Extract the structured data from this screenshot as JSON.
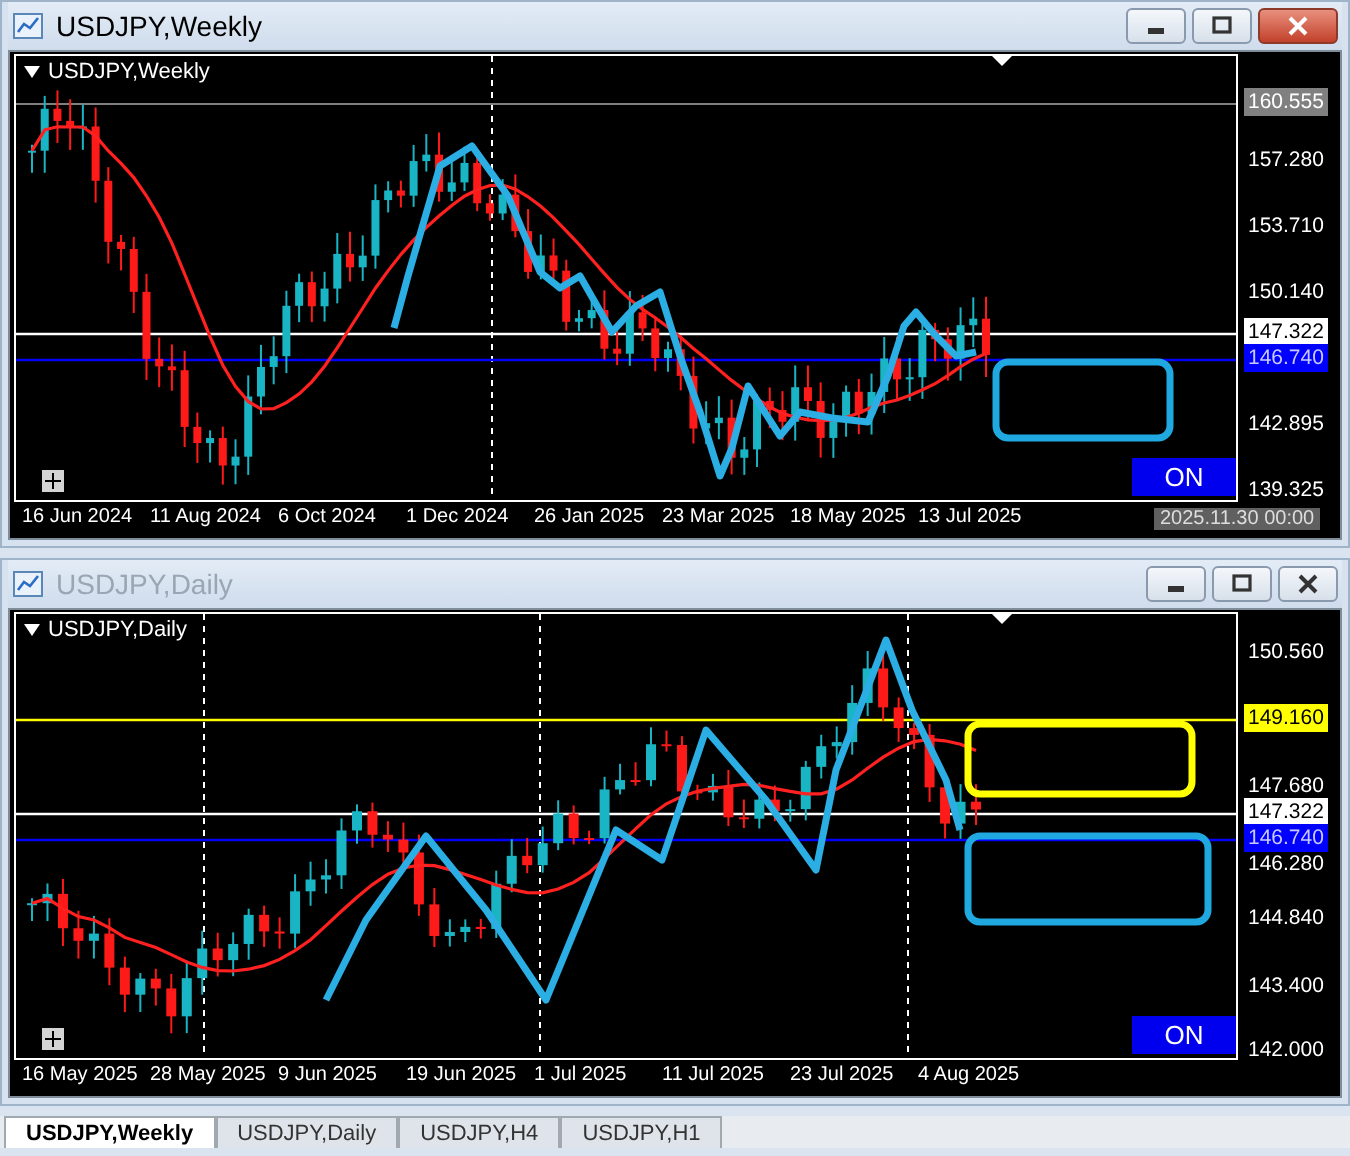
{
  "windows": [
    {
      "title": "USDJPY,Weekly",
      "active": true,
      "symbol_label": "USDJPY,Weekly",
      "price_axis": [
        {
          "kind": "max",
          "text": "160.555"
        },
        {
          "kind": "tick",
          "text": "157.280"
        },
        {
          "kind": "tick",
          "text": "153.710"
        },
        {
          "kind": "tick",
          "text": "150.140"
        },
        {
          "kind": "tag",
          "text": "147.322",
          "color": "#ffffff"
        },
        {
          "kind": "tag",
          "text": "146.740",
          "color": "#0000ff"
        },
        {
          "kind": "tick",
          "text": "142.895"
        },
        {
          "kind": "tick",
          "text": "139.325"
        }
      ],
      "time_axis": [
        "16 Jun 2024",
        "11 Aug 2024",
        "6 Oct 2024",
        "1 Dec 2024",
        "26 Jan 2025",
        "23 Mar 2025",
        "18 May 2025",
        "13 Jul 2025"
      ],
      "cursor_time": "2025.11.30 00:00",
      "on_button": "ON"
    },
    {
      "title": "USDJPY,Daily",
      "active": false,
      "symbol_label": "USDJPY,Daily",
      "price_axis": [
        {
          "kind": "tick",
          "text": "150.560"
        },
        {
          "kind": "tag",
          "text": "149.160",
          "color": "#ffff00"
        },
        {
          "kind": "tick",
          "text": "147.680"
        },
        {
          "kind": "tag",
          "text": "147.322",
          "color": "#ffffff"
        },
        {
          "kind": "tag",
          "text": "146.740",
          "color": "#0000ff"
        },
        {
          "kind": "tick",
          "text": "146.280"
        },
        {
          "kind": "tick",
          "text": "144.840"
        },
        {
          "kind": "tick",
          "text": "143.400"
        },
        {
          "kind": "tick",
          "text": "142.000"
        }
      ],
      "time_axis": [
        "16 May 2025",
        "28 May 2025",
        "9 Jun 2025",
        "19 Jun 2025",
        "1 Jul 2025",
        "11 Jul 2025",
        "23 Jul 2025",
        "4 Aug 2025"
      ],
      "on_button": "ON"
    }
  ],
  "tabs": [
    {
      "label": "USDJPY,Weekly",
      "selected": true
    },
    {
      "label": "USDJPY,Daily",
      "selected": false
    },
    {
      "label": "USDJPY,H4",
      "selected": false
    },
    {
      "label": "USDJPY,H1",
      "selected": false
    }
  ]
}
